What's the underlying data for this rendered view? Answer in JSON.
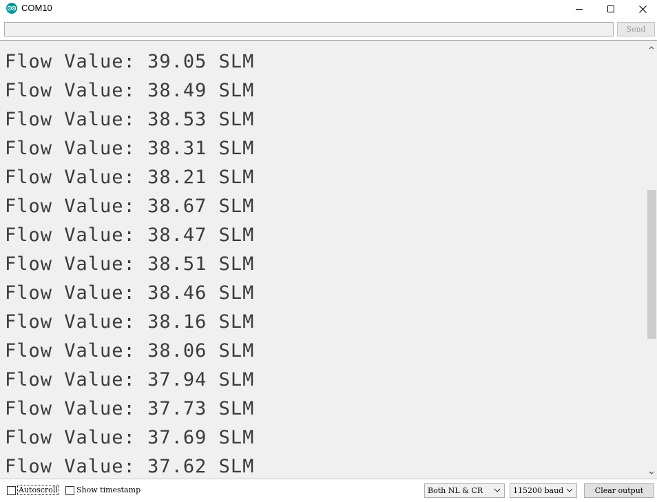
{
  "window": {
    "title": "COM10",
    "icon": "arduino-logo-icon",
    "controls": [
      "minimize-icon",
      "maximize-icon",
      "close-icon"
    ]
  },
  "send_bar": {
    "input_value": "",
    "send_label": "Send"
  },
  "output": {
    "lines": [
      "Flow Value: 39.05 SLM",
      "Flow Value: 38.49 SLM",
      "Flow Value: 38.53 SLM",
      "Flow Value: 38.31 SLM",
      "Flow Value: 38.21 SLM",
      "Flow Value: 38.67 SLM",
      "Flow Value: 38.47 SLM",
      "Flow Value: 38.51 SLM",
      "Flow Value: 38.46 SLM",
      "Flow Value: 38.16 SLM",
      "Flow Value: 38.06 SLM",
      "Flow Value: 37.94 SLM",
      "Flow Value: 37.73 SLM",
      "Flow Value: 37.69 SLM",
      "Flow Value: 37.62 SLM"
    ]
  },
  "bottom_bar": {
    "autoscroll_label": "Autoscroll",
    "autoscroll_checked": false,
    "timestamp_label": "Show timestamp",
    "timestamp_checked": false,
    "line_ending": "Both NL & CR",
    "baud_rate": "115200 baud",
    "clear_label": "Clear output"
  },
  "colors": {
    "arduino_teal": "#00979c",
    "output_bg": "#f0f0f0",
    "output_text": "#3b3b3b"
  }
}
